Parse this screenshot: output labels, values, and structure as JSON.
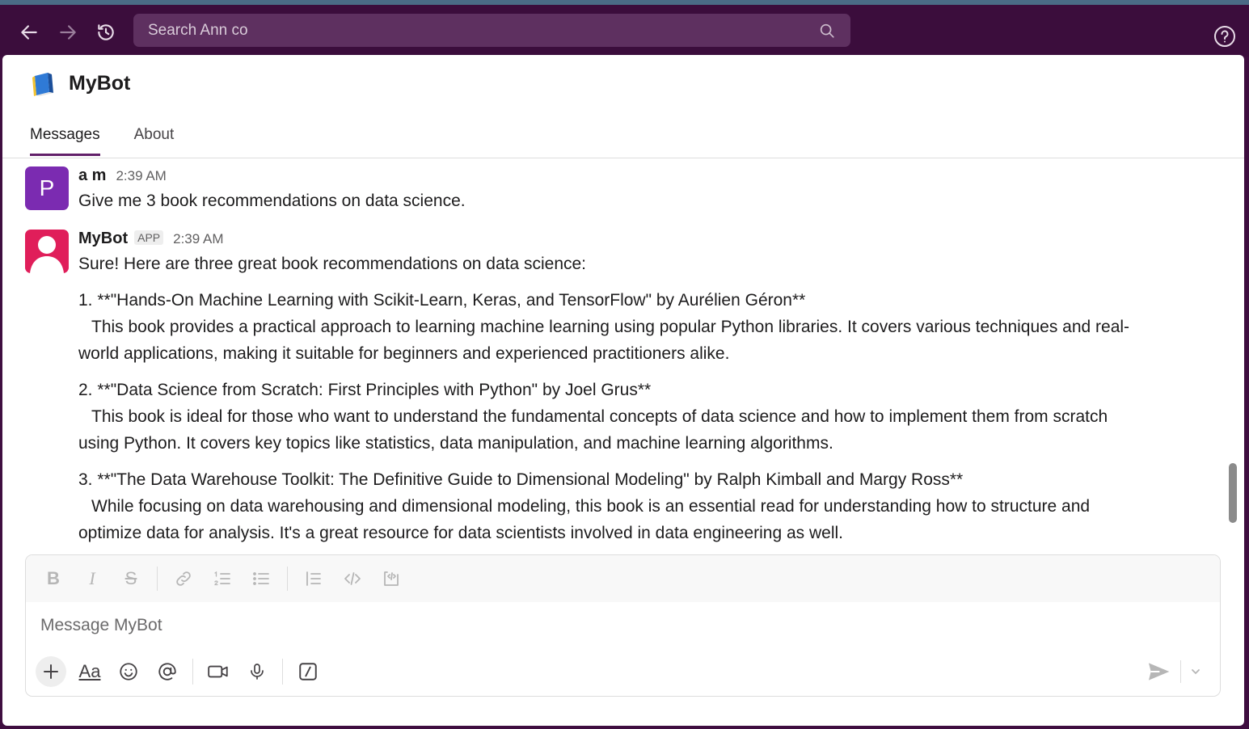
{
  "search": {
    "placeholder": "Search Ann co"
  },
  "header": {
    "title": "MyBot"
  },
  "tabs": [
    {
      "label": "Messages",
      "active": true
    },
    {
      "label": "About",
      "active": false
    }
  ],
  "messages": [
    {
      "avatar_letter": "P",
      "author": "a m",
      "time": "2:39 AM",
      "lines": [
        "Give me 3 book recommendations on data science."
      ]
    },
    {
      "author": "MyBot",
      "badge": "APP",
      "time": "2:39 AM",
      "intro": "Sure! Here are three great book recommendations on data science:",
      "items": [
        {
          "title": "1. **\"Hands-On Machine Learning with Scikit-Learn, Keras, and TensorFlow\" by Aurélien Géron**",
          "desc_first": "This book provides a practical approach to learning machine learning using popular Python libraries. It covers various techniques and real-",
          "desc_rest": "world applications, making it suitable for beginners and experienced practitioners alike."
        },
        {
          "title": "2. **\"Data Science from Scratch: First Principles with Python\" by Joel Grus**",
          "desc_first": "This book is ideal for those who want to understand the fundamental concepts of data science and how to implement them from scratch",
          "desc_rest": "using Python. It covers key topics like statistics, data manipulation, and machine learning algorithms."
        },
        {
          "title": "3. **\"The Data Warehouse Toolkit: The Definitive Guide to Dimensional Modeling\" by Ralph Kimball and Margy Ross**",
          "desc_first": "While focusing on data warehousing and dimensional modeling, this book is an essential read for understanding how to structure and",
          "desc_rest": "optimize data for analysis. It's a great resource for data scientists involved in data engineering as well."
        }
      ]
    }
  ],
  "composer": {
    "placeholder": "Message MyBot",
    "format_buttons": [
      "B",
      "I",
      "S"
    ],
    "text_format_label": "Aa"
  },
  "colors": {
    "sidebar_bg": "#3b0d3c",
    "search_bg": "#5e3060",
    "tab_underline": "#611f69",
    "user_avatar": "#7b2bb1",
    "bot_avatar": "#e01e5a"
  }
}
